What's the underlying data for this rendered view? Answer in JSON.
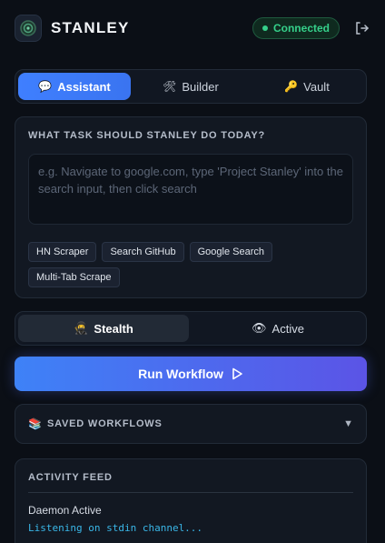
{
  "header": {
    "brand": "STANLEY",
    "status": "Connected",
    "colors": {
      "accent": "#3f7fff",
      "status": "#35d08a"
    },
    "icons": {
      "logo": "robot-icon",
      "logout": "logout-icon"
    }
  },
  "tabs": [
    {
      "label": "Assistant",
      "icon": "chat-icon",
      "glyph": "💬",
      "active": true
    },
    {
      "label": "Builder",
      "icon": "tools-icon",
      "glyph": "🛠",
      "active": false
    },
    {
      "label": "Vault",
      "icon": "key-icon",
      "glyph": "🔑",
      "active": false
    }
  ],
  "task": {
    "label": "WHAT TASK SHOULD STANLEY DO TODAY?",
    "placeholder": "e.g. Navigate to google.com, type 'Project Stanley' into the search input, then click search",
    "chips": [
      "HN Scraper",
      "Search GitHub",
      "Google Search",
      "Multi-Tab Scrape"
    ]
  },
  "modes": [
    {
      "label": "Stealth",
      "icon": "ninja-icon",
      "glyph": "🥷",
      "active": true
    },
    {
      "label": "Active",
      "icon": "eye-icon",
      "glyph": "👁",
      "active": false
    }
  ],
  "run": {
    "label": "Run Workflow",
    "icon": "play-icon"
  },
  "saved": {
    "label": "SAVED WORKFLOWS",
    "icon": "books-icon",
    "glyph": "📚"
  },
  "activity": {
    "label": "ACTIVITY FEED",
    "status_line": "Daemon Active",
    "log_line": "Listening on stdin channel..."
  }
}
